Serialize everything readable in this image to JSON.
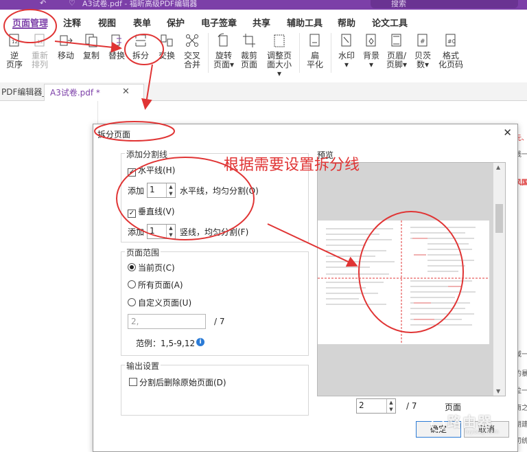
{
  "titlebar": {
    "title": "A3试卷.pdf - 福昕高级PDF编辑器",
    "search_placeholder": "搜索"
  },
  "menu": {
    "items": [
      "页面管理",
      "注释",
      "视图",
      "表单",
      "保护",
      "电子签章",
      "共享",
      "辅助工具",
      "帮助",
      "论文工具"
    ],
    "active": "页面管理"
  },
  "ribbon": {
    "buttons": [
      {
        "label1": "逆",
        "label2": "页序"
      },
      {
        "label1": "重新",
        "label2": "排列"
      },
      {
        "label1": "移动",
        "label2": ""
      },
      {
        "label1": "复制",
        "label2": ""
      },
      {
        "label1": "替换",
        "label2": ""
      },
      {
        "label1": "拆分",
        "label2": ""
      },
      {
        "label1": "交换",
        "label2": ""
      },
      {
        "label1": "交叉",
        "label2": "合并"
      },
      {
        "label1": "旋转",
        "label2": "页面"
      },
      {
        "label1": "裁剪",
        "label2": "页面"
      },
      {
        "label1": "调整页",
        "label2": "面大小"
      },
      {
        "label1": "扁",
        "label2": "平化"
      },
      {
        "label1": "水印",
        "label2": ""
      },
      {
        "label1": "背景",
        "label2": ""
      },
      {
        "label1": "页眉/",
        "label2": "页脚"
      },
      {
        "label1": "贝茨",
        "label2": "数"
      },
      {
        "label1": "格式",
        "label2": "化页码"
      }
    ]
  },
  "tabs": [
    {
      "label": "PDF编辑器_..."
    },
    {
      "label": "A3试卷.pdf *"
    }
  ],
  "doc_right": [
    "元、",
    "线一",
    "风国",
    "域一",
    "的暴",
    "位一",
    "南之",
    "朗建",
    "初统"
  ],
  "dialog": {
    "title": "拆分页面",
    "add_split_lines": {
      "title": "添加分割线",
      "horizontal_label": "水平线(H)",
      "horizontal_checked": true,
      "add_label": "添加",
      "h_count": "1",
      "h_suffix": "水平线，均匀分割(O)",
      "vertical_label": "垂直线(V)",
      "vertical_checked": true,
      "v_count": "1",
      "v_suffix": "竖线，均匀分割(F)"
    },
    "page_range": {
      "title": "页面范围",
      "current": "当前页(C)",
      "all": "所有页面(A)",
      "custom": "自定义页面(U)",
      "selected": "current",
      "custom_value": "2,",
      "total": "/  7",
      "example": "范例：1,5-9,12"
    },
    "output": {
      "title": "输出设置",
      "delete_original": "分割后删除原始页面(D)",
      "delete_checked": false
    },
    "preview": {
      "title": "预览",
      "page_value": "2",
      "total": "/   7",
      "unit": "页面"
    },
    "ok": "确定",
    "cancel": "取消"
  },
  "annotation": {
    "text": "根据需要设置拆分线",
    "color": "#e03434"
  },
  "watermark": {
    "text": "路由器",
    "sub": "luyouqi.com"
  },
  "colors": {
    "brand": "#7c3fa8",
    "annotation_red": "#e03434",
    "link_blue": "#2b7bd6"
  }
}
